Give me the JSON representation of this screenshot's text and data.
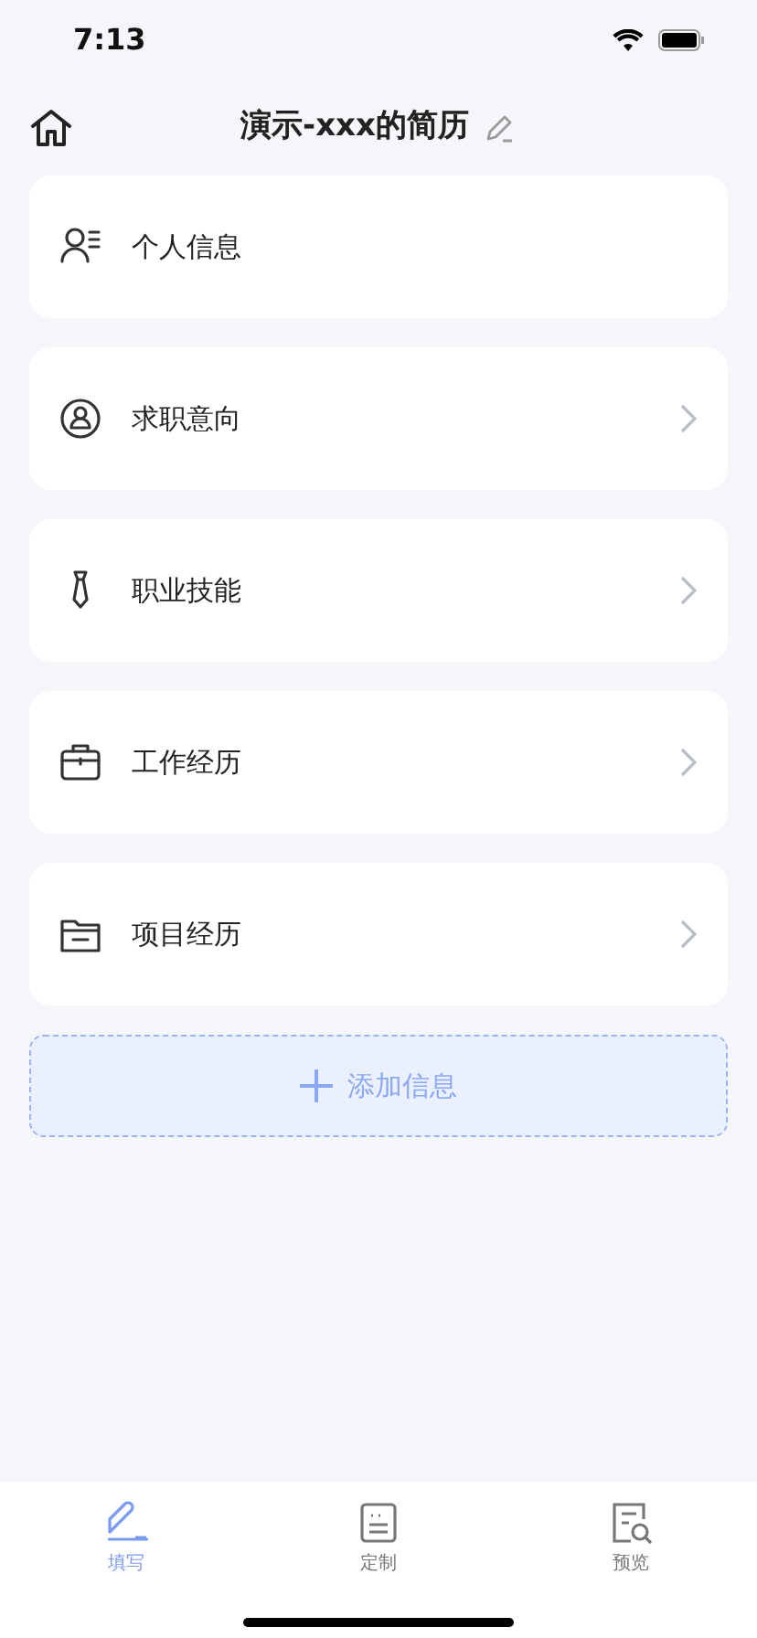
{
  "status_bar": {
    "time": "7:13"
  },
  "header": {
    "title": "演示-xxx的简历"
  },
  "sections": [
    {
      "kind": "person",
      "label": "个人信息",
      "chevron": false
    },
    {
      "kind": "target",
      "label": "求职意向",
      "chevron": true
    },
    {
      "kind": "tie",
      "label": "职业技能",
      "chevron": true
    },
    {
      "kind": "briefcase",
      "label": "工作经历",
      "chevron": true
    },
    {
      "kind": "folder",
      "label": "项目经历",
      "chevron": true
    }
  ],
  "add_button": {
    "label": "添加信息"
  },
  "tabs": [
    {
      "kind": "pen",
      "label": "填写",
      "selected": true
    },
    {
      "kind": "board",
      "label": "定制",
      "selected": false
    },
    {
      "kind": "preview",
      "label": "预览",
      "selected": false
    }
  ]
}
